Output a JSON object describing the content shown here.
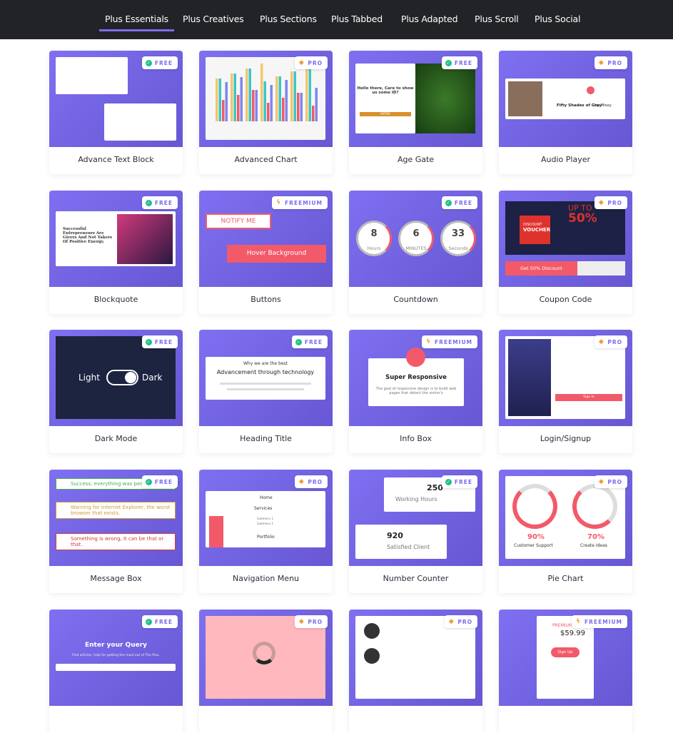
{
  "nav": {
    "tabs": [
      {
        "label": "Plus Essentials",
        "active": true
      },
      {
        "label": "Plus Creatives"
      },
      {
        "label": "Plus Sections"
      },
      {
        "label": "Plus Tabbed"
      },
      {
        "label": "Plus Adapted"
      },
      {
        "label": "Plus Scroll"
      },
      {
        "label": "Plus Social"
      }
    ],
    "accent": "#7b6cf0"
  },
  "badges": {
    "free": "FREE",
    "pro": "PRO",
    "freemium": "FREEMIUM"
  },
  "cards": [
    {
      "title": "Advance Text Block",
      "tier": "free"
    },
    {
      "title": "Advanced Chart",
      "tier": "pro"
    },
    {
      "title": "Age Gate",
      "tier": "free",
      "preview": {
        "heading": "Hello there, Care to show us some ID?",
        "button": "ENTER"
      }
    },
    {
      "title": "Audio Player",
      "tier": "pro",
      "preview": {
        "track": "Fifty Shades of Gray",
        "by": "by Missy"
      }
    },
    {
      "title": "Blockquote",
      "tier": "free",
      "preview": {
        "quote": "Successful Entrepreneurs Are Givers And Not Takers Of Positive Energy."
      }
    },
    {
      "title": "Buttons",
      "tier": "freemium",
      "preview": {
        "btn1": "NOTIFY ME",
        "btn2": "Hover Background"
      }
    },
    {
      "title": "Countdown",
      "tier": "free",
      "preview": {
        "units": [
          {
            "value": "8",
            "label": "Hours"
          },
          {
            "value": "6",
            "label": "MINUTES"
          },
          {
            "value": "33",
            "label": "Seconds"
          }
        ]
      }
    },
    {
      "title": "Coupon Code",
      "tier": "pro",
      "preview": {
        "discount": "DISCOUNT",
        "voucher": "VOUCHER",
        "upto": "UP TO",
        "percent": "50%",
        "cta": "Get 50% Discount"
      }
    },
    {
      "title": "Dark Mode",
      "tier": "free",
      "preview": {
        "light": "Light",
        "dark": "Dark"
      }
    },
    {
      "title": "Heading Title",
      "tier": "free",
      "preview": {
        "sub": "Why we are the best",
        "heading": "Advancement through technology"
      }
    },
    {
      "title": "Info Box",
      "tier": "freemium",
      "preview": {
        "heading": "Super Responsive",
        "text": "The goal of responsive design is to build web pages that detect the visitor's"
      }
    },
    {
      "title": "Login/Signup",
      "tier": "pro",
      "preview": {
        "button": "Sign In"
      }
    },
    {
      "title": "Message Box",
      "tier": "free",
      "preview": {
        "success": "Success, everything was perfect",
        "warning": "Warning for internet Explorer, the worst browser that exists.",
        "error": "Something is wrong, it can be that or that."
      }
    },
    {
      "title": "Navigation Menu",
      "tier": "pro",
      "preview": {
        "items": [
          "Home",
          "Services",
          "Portfolio"
        ],
        "sub": [
          "Submenu 1",
          "Submenu 1"
        ]
      }
    },
    {
      "title": "Number Counter",
      "tier": "free",
      "preview": {
        "n1": "250",
        "l1": "Working Hours",
        "n2": "920",
        "l2": "Satisfied Client"
      }
    },
    {
      "title": "Pie Chart",
      "tier": "pro",
      "preview": {
        "p1": "90%",
        "l1": "Customer Support",
        "p2": "70%",
        "l2": "Create Ideas"
      }
    },
    {
      "title": "",
      "tier": "free",
      "preview": {
        "heading": "Enter your Query",
        "text": "Find articles, help for getting the most out of The Plus."
      }
    },
    {
      "title": "",
      "tier": "pro"
    },
    {
      "title": "",
      "tier": "pro"
    },
    {
      "title": "",
      "tier": "freemium",
      "preview": {
        "plan": "PREMIUM",
        "price": "$59.99",
        "button": "Sign Up"
      }
    }
  ]
}
